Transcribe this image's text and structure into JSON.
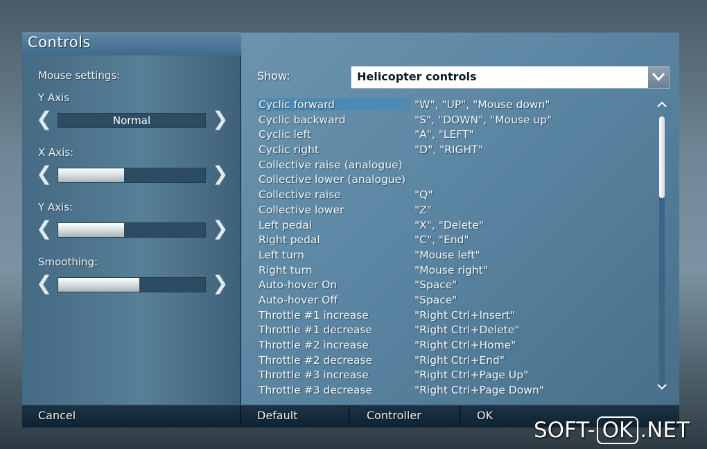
{
  "window": {
    "title": "Controls"
  },
  "mouse_settings": {
    "heading": "Mouse settings:",
    "settings": [
      {
        "label": "Y Axis",
        "value_text": "Normal",
        "fill_fraction": null
      },
      {
        "label": "X Axis:",
        "value_text": "",
        "fill_fraction": 0.45
      },
      {
        "label": "Y Axis:",
        "value_text": "",
        "fill_fraction": 0.45
      },
      {
        "label": "Smoothing:",
        "value_text": "",
        "fill_fraction": 0.55
      }
    ],
    "left_arrow": "❮",
    "right_arrow": "❯"
  },
  "show": {
    "label": "Show:",
    "selected": "Helicopter controls"
  },
  "controls": [
    {
      "action": "Cyclic forward",
      "keys": "\"W\", \"UP\", \"Mouse down\"",
      "selected": true
    },
    {
      "action": "Cyclic backward",
      "keys": "\"S\", \"DOWN\", \"Mouse up\""
    },
    {
      "action": "Cyclic left",
      "keys": "\"A\", \"LEFT\""
    },
    {
      "action": "Cyclic right",
      "keys": "\"D\", \"RIGHT\""
    },
    {
      "action": "Collective raise (analogue)",
      "keys": ""
    },
    {
      "action": "Collective lower (analogue)",
      "keys": ""
    },
    {
      "action": "Collective raise",
      "keys": "\"Q\""
    },
    {
      "action": "Collective lower",
      "keys": "\"Z\""
    },
    {
      "action": "Left pedal",
      "keys": "\"X\", \"Delete\""
    },
    {
      "action": "Right pedal",
      "keys": "\"C\", \"End\""
    },
    {
      "action": "Left turn",
      "keys": "\"Mouse left\""
    },
    {
      "action": "Right turn",
      "keys": "\"Mouse right\""
    },
    {
      "action": "Auto-hover On",
      "keys": "\"Space\""
    },
    {
      "action": "Auto-hover Off",
      "keys": "\"Space\""
    },
    {
      "action": "Throttle #1 increase",
      "keys": "\"Right Ctrl+Insert\""
    },
    {
      "action": "Throttle #1 decrease",
      "keys": "\"Right Ctrl+Delete\""
    },
    {
      "action": "Throttle #2 increase",
      "keys": "\"Right Ctrl+Home\""
    },
    {
      "action": "Throttle #2 decrease",
      "keys": "\"Right Ctrl+End\""
    },
    {
      "action": "Throttle #3 increase",
      "keys": "\"Right Ctrl+Page Up\""
    },
    {
      "action": "Throttle #3 decrease",
      "keys": "\"Right Ctrl+Page Down\""
    }
  ],
  "scroll": {
    "up_icon": "chevron-up-icon",
    "down_icon": "chevron-down-icon"
  },
  "buttons": {
    "cancel": "Cancel",
    "default": "Default",
    "controller": "Controller",
    "ok": "OK"
  },
  "watermark": {
    "left": "SOFT-",
    "box": "OK",
    "right": ".NET"
  },
  "colors": {
    "accent": "#4d8ab3",
    "panel": "#5b86a3",
    "bar": "#0f2333"
  }
}
